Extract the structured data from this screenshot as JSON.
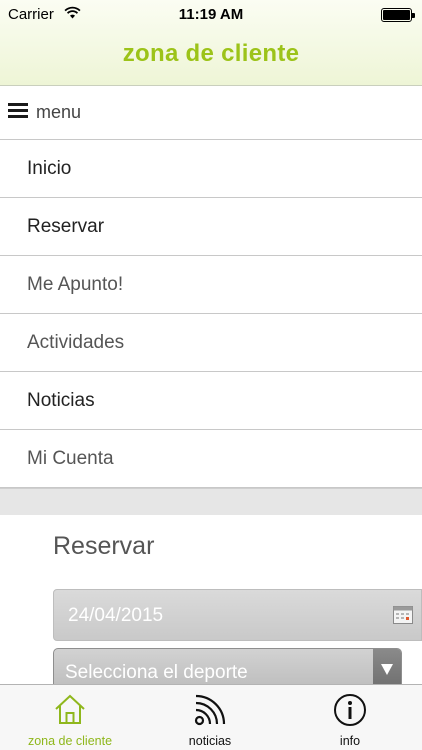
{
  "status_bar": {
    "carrier": "Carrier",
    "time": "11:19 AM"
  },
  "header": {
    "title": "zona de cliente",
    "accent_color": "#9cc319"
  },
  "menu": {
    "label": "menu",
    "items": [
      {
        "label": "Inicio"
      },
      {
        "label": "Reservar"
      },
      {
        "label": "Me Apunto!"
      },
      {
        "label": "Actividades"
      },
      {
        "label": "Noticias"
      },
      {
        "label": "Mi Cuenta"
      }
    ]
  },
  "form": {
    "title": "Reservar",
    "date_value": "24/04/2015",
    "sport_select": "Selecciona el deporte"
  },
  "tabbar": {
    "tabs": [
      {
        "label": "zona de cliente",
        "icon": "home-icon",
        "active": true
      },
      {
        "label": "noticias",
        "icon": "rss-icon",
        "active": false
      },
      {
        "label": "info",
        "icon": "info-icon",
        "active": false
      }
    ]
  }
}
